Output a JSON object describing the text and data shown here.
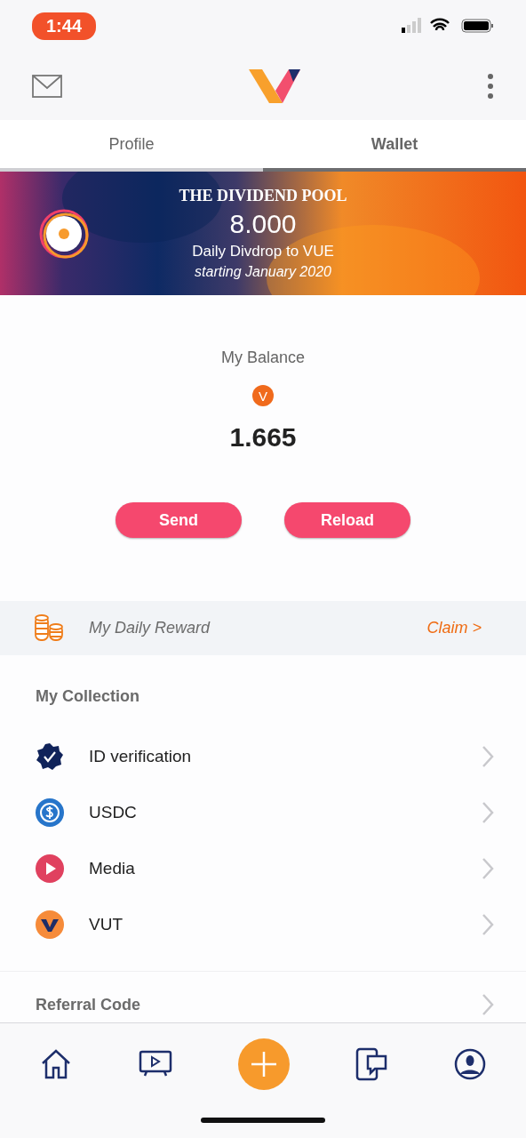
{
  "status_bar": {
    "time": "1:44"
  },
  "tabs": [
    {
      "label": "Profile",
      "selected": false
    },
    {
      "label": "Wallet",
      "selected": true
    }
  ],
  "banner": {
    "title": "THE DIVIDEND POOL",
    "amount": "8.000",
    "subtitle": "Daily Divdrop to VUE",
    "note": "starting January 2020"
  },
  "balance": {
    "label": "My Balance",
    "currency_symbol": "V",
    "amount": "1.665"
  },
  "buttons": [
    "Send",
    "Reload"
  ],
  "daily_reward": {
    "label": "My Daily Reward",
    "action": "Claim >"
  },
  "collection": {
    "title": "My Collection",
    "items": [
      {
        "label": "ID verification",
        "kind": "verified"
      },
      {
        "label": "USDC",
        "kind": "usdc"
      },
      {
        "label": "Media",
        "kind": "media"
      },
      {
        "label": "VUT",
        "kind": "vut"
      }
    ]
  },
  "referral": {
    "title": "Referral Code"
  },
  "bottom_nav": [
    {
      "kind": "home"
    },
    {
      "kind": "tv"
    },
    {
      "kind": "add"
    },
    {
      "kind": "chat"
    },
    {
      "kind": "profile"
    }
  ]
}
